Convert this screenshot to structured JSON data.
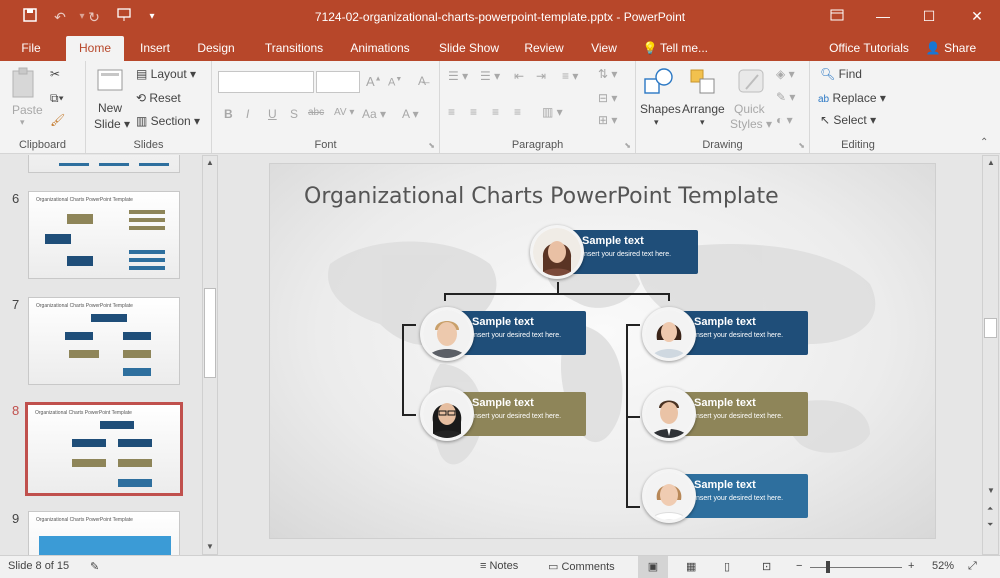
{
  "window": {
    "title": "7124-02-organizational-charts-powerpoint-template.pptx - PowerPoint"
  },
  "tabs": [
    {
      "label": "File"
    },
    {
      "label": "Home"
    },
    {
      "label": "Insert"
    },
    {
      "label": "Design"
    },
    {
      "label": "Transitions"
    },
    {
      "label": "Animations"
    },
    {
      "label": "Slide Show"
    },
    {
      "label": "Review"
    },
    {
      "label": "View"
    },
    {
      "label": "Tell me..."
    }
  ],
  "account": {
    "name": "Office Tutorials",
    "share": "Share"
  },
  "ribbon": {
    "clipboard": {
      "label": "Clipboard",
      "paste": "Paste"
    },
    "slides": {
      "label": "Slides",
      "new_slide_1": "New",
      "new_slide_2": "Slide",
      "layout": "Layout",
      "reset": "Reset",
      "section": "Section"
    },
    "font": {
      "label": "Font",
      "bold": "B",
      "italic": "I",
      "underline": "U",
      "shadow": "S",
      "strike": "abc",
      "spacing": "AV",
      "case": "Aa",
      "grow": "A",
      "shrink": "A"
    },
    "paragraph": {
      "label": "Paragraph"
    },
    "drawing": {
      "label": "Drawing",
      "shapes": "Shapes",
      "arrange": "Arrange",
      "quick_1": "Quick",
      "quick_2": "Styles"
    },
    "editing": {
      "label": "Editing",
      "find": "Find",
      "replace": "Replace",
      "select": "Select"
    }
  },
  "thumbnails": [
    {
      "number": "6",
      "title": "Organizational Charts PowerPoint Template"
    },
    {
      "number": "7",
      "title": "Organizational Charts PowerPoint Template"
    },
    {
      "number": "8",
      "title": "Organizational Charts PowerPoint Template"
    },
    {
      "number": "9",
      "title": "Organizational Charts PowerPoint Template"
    }
  ],
  "slide": {
    "title": "Organizational Charts PowerPoint Template",
    "nodes": [
      {
        "heading": "Sample text",
        "desc": "Insert your desired text here."
      },
      {
        "heading": "Sample text",
        "desc": "Insert your desired text here."
      },
      {
        "heading": "Sample text",
        "desc": "Insert your desired text here."
      },
      {
        "heading": "Sample text",
        "desc": "Insert your desired text here."
      },
      {
        "heading": "Sample text",
        "desc": "Insert your desired text here."
      },
      {
        "heading": "Sample text",
        "desc": "Insert your desired text here."
      }
    ]
  },
  "status": {
    "slide_counter": "Slide 8 of 15",
    "notes": "Notes",
    "comments": "Comments",
    "zoom": "52%"
  },
  "colors": {
    "accent": "#b7472a",
    "node_blue": "#1f4e79",
    "node_olive": "#8e8559",
    "node_light_blue": "#2e6f9e"
  }
}
